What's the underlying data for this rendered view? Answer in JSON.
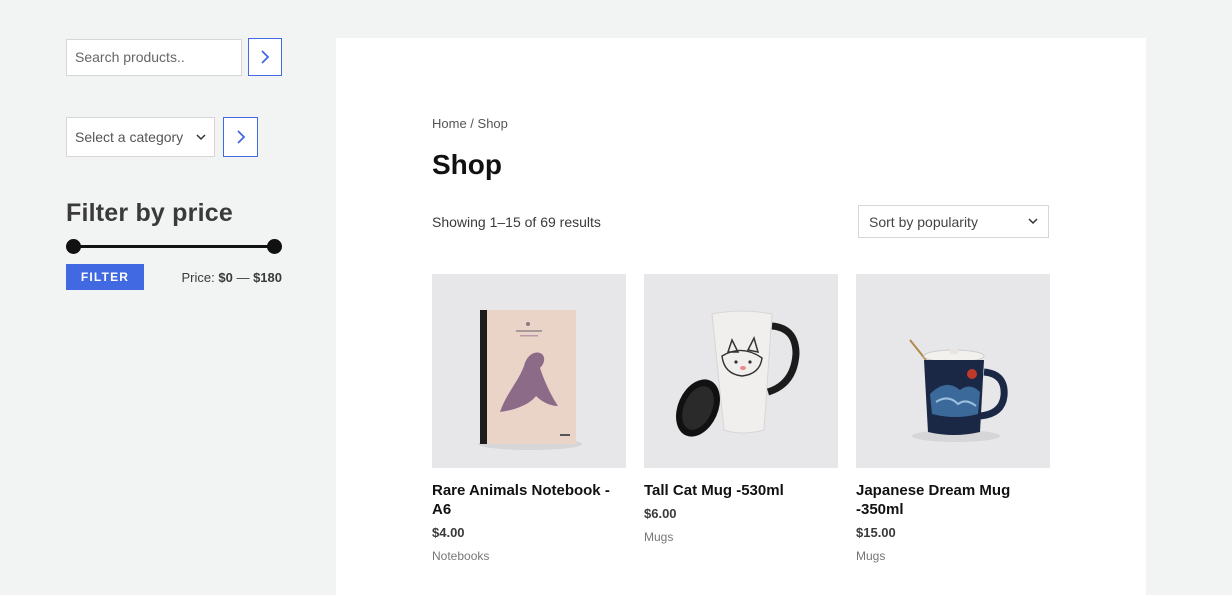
{
  "sidebar": {
    "search": {
      "placeholder": "Search products.."
    },
    "category": {
      "selected": "Select a category"
    },
    "filter": {
      "title": "Filter by price",
      "button_label": "FILTER",
      "price_prefix": "Price:",
      "min_price": "$0",
      "separator": " — ",
      "max_price": "$180",
      "range_fraction": [
        0,
        1
      ]
    }
  },
  "main": {
    "breadcrumb": {
      "home": "Home",
      "sep": " / ",
      "current": "Shop"
    },
    "title": "Shop",
    "result_count": "Showing 1–15 of 69 results",
    "sort": {
      "selected": "Sort by popularity"
    },
    "products": [
      {
        "title": "Rare Animals Notebook - A6",
        "price": "$4.00",
        "category": "Notebooks"
      },
      {
        "title": "Tall Cat Mug -530ml",
        "price": "$6.00",
        "category": "Mugs"
      },
      {
        "title": "Japanese Dream Mug -350ml",
        "price": "$15.00",
        "category": "Mugs"
      }
    ]
  },
  "colors": {
    "accent": "#4169e1",
    "panel": "#ffffff",
    "background": "#f2f3f3"
  },
  "icons": [
    "chevron-right-icon",
    "chevron-down-icon"
  ]
}
